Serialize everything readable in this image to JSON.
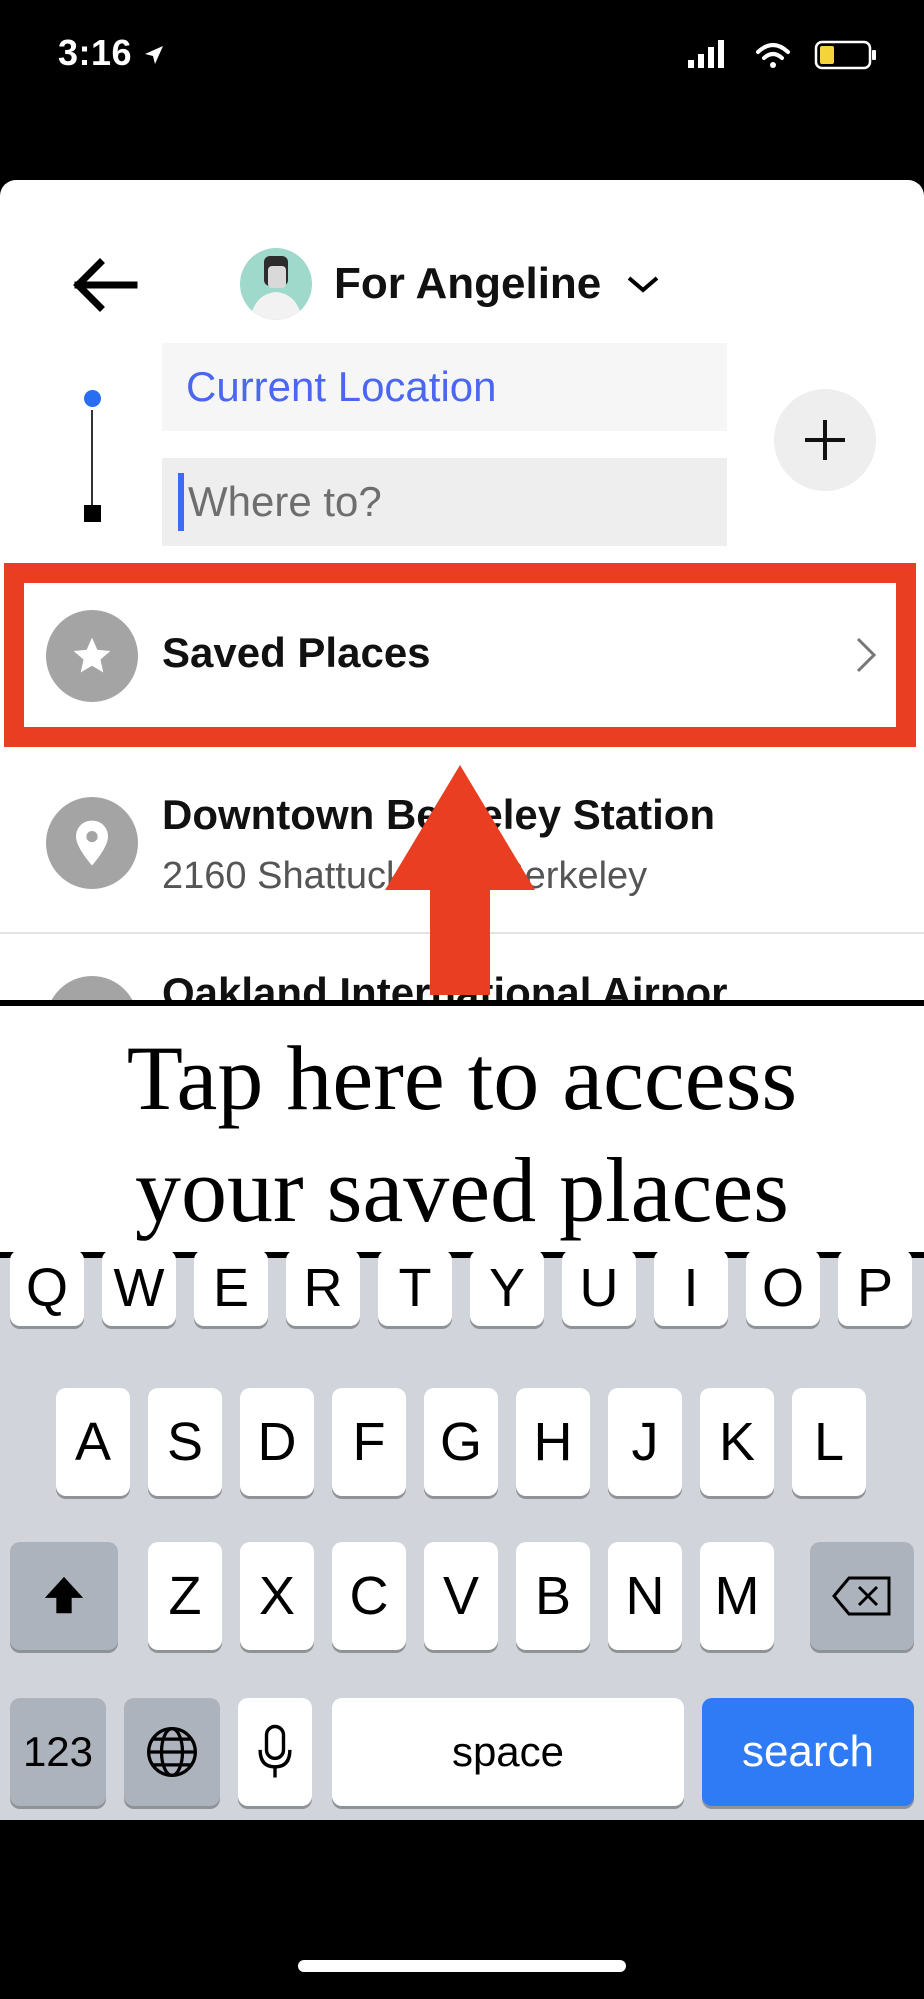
{
  "status_bar": {
    "time": "3:16"
  },
  "header": {
    "rider_label": "For Angeline"
  },
  "route": {
    "pickup_value": "Current Location",
    "destination_placeholder": "Where to?"
  },
  "list": {
    "saved_places_label": "Saved Places",
    "items": [
      {
        "title": "Downtown Berkeley Station",
        "subtitle": "2160 Shattuck Ave, Berkeley"
      },
      {
        "title": "Oakland International Airpor"
      }
    ]
  },
  "annotation": {
    "line1": "Tap here to access",
    "line2": "your saved places",
    "highlight_color": "#ea3e23"
  },
  "keyboard": {
    "row1": [
      "Q",
      "W",
      "E",
      "R",
      "T",
      "Y",
      "U",
      "I",
      "O",
      "P"
    ],
    "row2": [
      "A",
      "S",
      "D",
      "F",
      "G",
      "H",
      "J",
      "K",
      "L"
    ],
    "row3": [
      "Z",
      "X",
      "C",
      "V",
      "B",
      "N",
      "M"
    ],
    "numbers_label": "123",
    "space_label": "space",
    "search_label": "search"
  },
  "colors": {
    "accent_blue": "#276ef1",
    "search_key": "#2f7bf5"
  }
}
